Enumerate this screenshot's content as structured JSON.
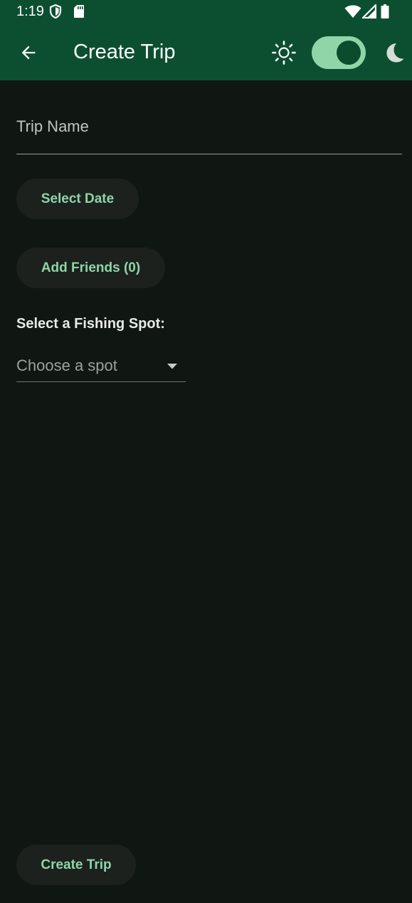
{
  "status_bar": {
    "time": "1:19",
    "icons": [
      "shield-icon",
      "sd-card-icon",
      "wifi-icon",
      "signal-icon",
      "battery-icon"
    ]
  },
  "app_bar": {
    "title": "Create Trip",
    "back_icon": "arrow-back-icon",
    "light_icon": "sun-icon",
    "dark_icon": "moon-icon",
    "dark_mode_enabled": true
  },
  "form": {
    "trip_name_placeholder": "Trip Name",
    "trip_name_value": "",
    "select_date_label": "Select Date",
    "add_friends_label": "Add Friends (0)",
    "fishing_spot_label": "Select a Fishing Spot:",
    "fishing_spot_placeholder": "Choose a spot",
    "create_trip_label": "Create Trip"
  },
  "colors": {
    "app_bar": "#0c4f30",
    "background": "#101612",
    "accent": "#8fd5a8",
    "button_bg": "#1c211e"
  }
}
